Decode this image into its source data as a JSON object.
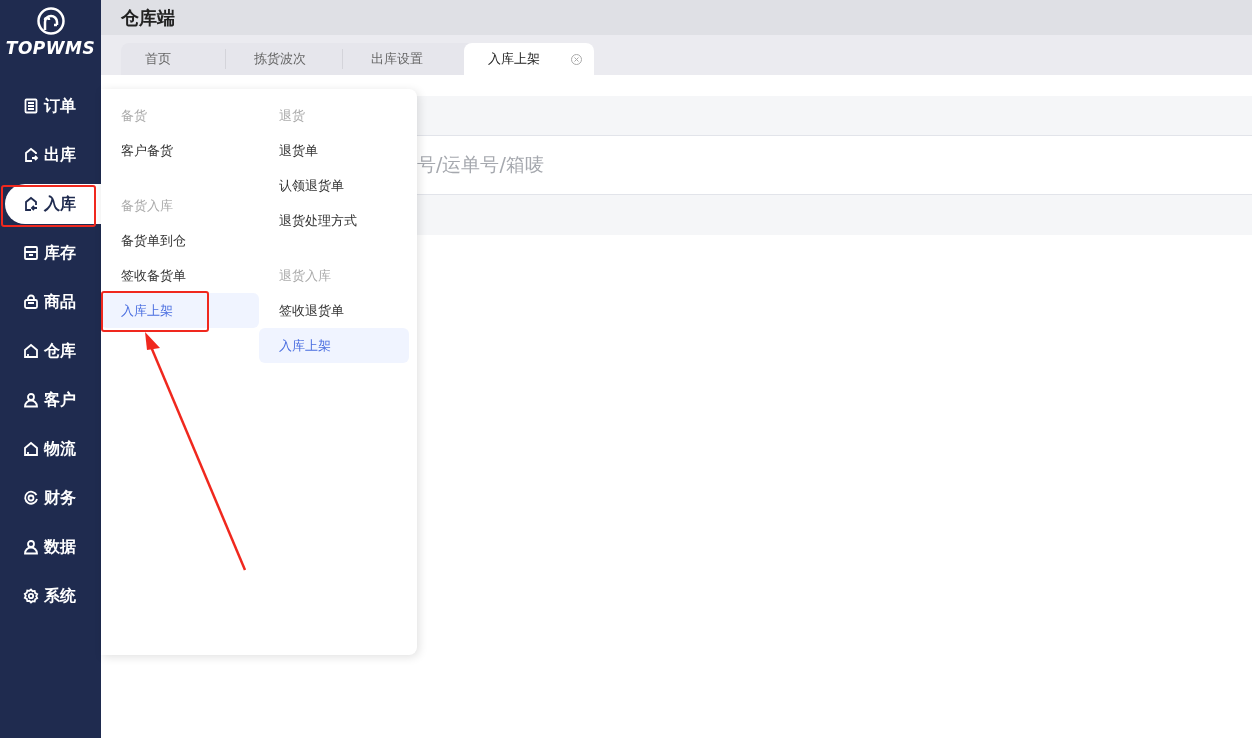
{
  "logo": {
    "text": "TOPWMS"
  },
  "sidebar": {
    "items": [
      {
        "label": "订单",
        "kind": "list",
        "selected": false
      },
      {
        "label": "出库",
        "kind": "out",
        "selected": false
      },
      {
        "label": "入库",
        "kind": "in",
        "selected": true
      },
      {
        "label": "库存",
        "kind": "box",
        "selected": false
      },
      {
        "label": "商品",
        "kind": "bag",
        "selected": false
      },
      {
        "label": "仓库",
        "kind": "house",
        "selected": false
      },
      {
        "label": "客户",
        "kind": "user",
        "selected": false
      },
      {
        "label": "物流",
        "kind": "house",
        "selected": false
      },
      {
        "label": "财务",
        "kind": "coin",
        "selected": false
      },
      {
        "label": "数据",
        "kind": "user",
        "selected": false
      },
      {
        "label": "系统",
        "kind": "gear",
        "selected": false
      }
    ]
  },
  "header": {
    "title": "仓库端"
  },
  "tabs": [
    {
      "label": "首页",
      "selected": false,
      "closable": false
    },
    {
      "label": "拣货波次",
      "selected": false,
      "closable": false
    },
    {
      "label": "出库设置",
      "selected": false,
      "closable": false
    },
    {
      "label": "入库上架",
      "selected": true,
      "closable": true
    }
  ],
  "search": {
    "placeholder": "号/运单号/箱唛"
  },
  "menu": {
    "columns": [
      {
        "groups": [
          {
            "heading": "备货",
            "items": [
              {
                "label": "客户备货",
                "selected": false
              }
            ]
          },
          {
            "heading": "备货入库",
            "items": [
              {
                "label": "备货单到仓",
                "selected": false
              },
              {
                "label": "签收备货单",
                "selected": false
              },
              {
                "label": "入库上架",
                "selected": true
              }
            ]
          }
        ]
      },
      {
        "groups": [
          {
            "heading": "退货",
            "items": [
              {
                "label": "退货单",
                "selected": false
              },
              {
                "label": "认领退货单",
                "selected": false
              },
              {
                "label": "退货处理方式",
                "selected": false
              }
            ]
          },
          {
            "heading": "退货入库",
            "items": [
              {
                "label": "签收退货单",
                "selected": false
              },
              {
                "label": "入库上架",
                "selected": true
              }
            ]
          }
        ]
      }
    ]
  }
}
